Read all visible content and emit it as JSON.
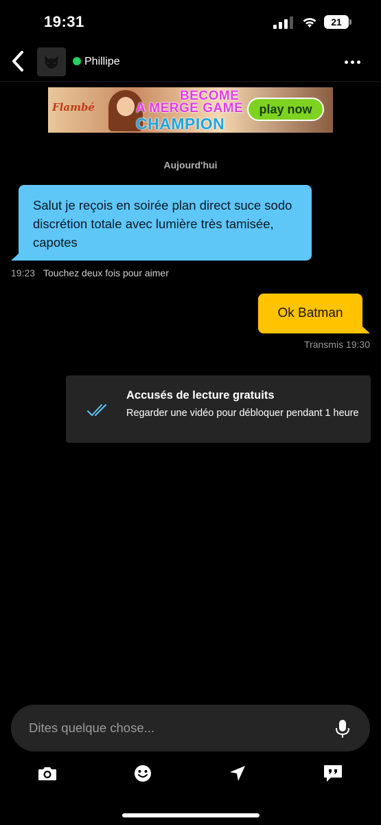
{
  "status_bar": {
    "time": "19:31",
    "battery_level": "21",
    "signal_bars_filled": 3,
    "signal_bars_total": 4
  },
  "header": {
    "contact_name": "Phillipe",
    "online": true,
    "online_color": "#23d160",
    "back_icon": "chevron-left-icon",
    "menu_icon": "more-dots-icon"
  },
  "ad": {
    "brand": "Flambé",
    "line1": "BECOME",
    "line2": "A MERGE GAME",
    "line3": "CHAMPION",
    "button": "play now"
  },
  "chat": {
    "date_label": "Aujourd'hui",
    "messages": [
      {
        "direction": "incoming",
        "text": "Salut je reçois en soirée plan direct suce sodo discrétion totale avec lumière très tamisée, capotes",
        "time": "19:23",
        "hint": "Touchez deux fois pour aimer",
        "color": "#5fc6f8"
      },
      {
        "direction": "outgoing",
        "text": "Ok Batman",
        "status": "Transmis 19:30",
        "color": "#ffc300"
      }
    ]
  },
  "read_receipts": {
    "title": "Accusés de lecture gratuits",
    "description": "Regarder une vidéo pour débloquer pendant 1 heure",
    "icon": "double-check-icon",
    "icon_color": "#5fc6f8"
  },
  "composer": {
    "placeholder": "Dites quelque chose...",
    "value": "",
    "mic_icon": "microphone-icon"
  },
  "toolbar": {
    "items": [
      "camera-icon",
      "emoji-icon",
      "location-arrow-icon",
      "quick-replies-icon"
    ]
  }
}
